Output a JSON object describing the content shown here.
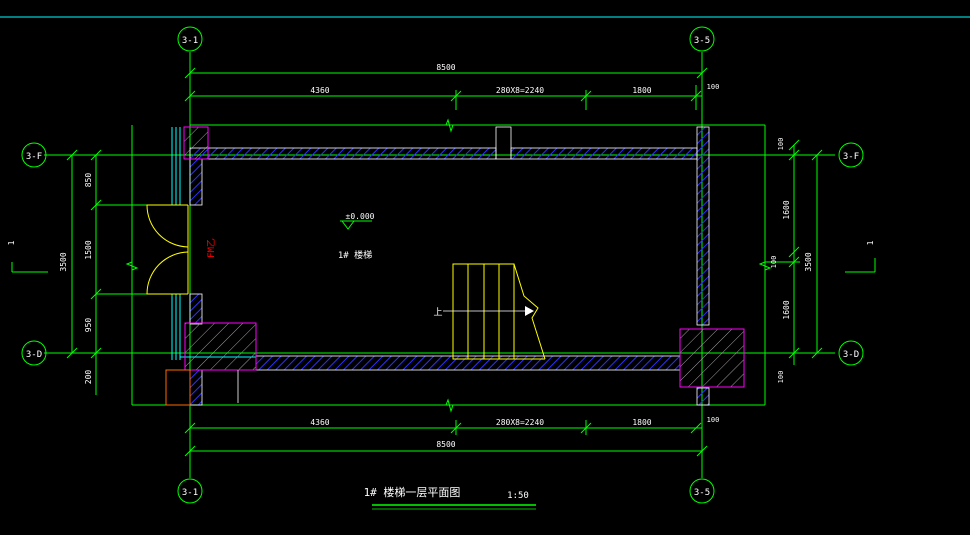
{
  "drawing": {
    "title": "1# 楼梯一层平面图",
    "scale": "1:50",
    "room_label": "1# 楼梯",
    "elevation_mark": "±0.000",
    "stair_up_label": "上",
    "door_tag": "FM乙",
    "section_mark_left": "1",
    "section_mark_right": "1"
  },
  "axes": {
    "top_left": "3-1",
    "top_right": "3-5",
    "bottom_left": "3-1",
    "bottom_right": "3-5",
    "left_top": "3-F",
    "left_bottom": "3-D",
    "right_top": "3-F",
    "right_bottom": "3-D"
  },
  "dimensions": {
    "top_total": "8500",
    "top_seg_1": "4360",
    "top_seg_2": "280X8=2240",
    "top_seg_3": "1800",
    "top_seg_4": "100",
    "bottom_total": "8500",
    "bottom_seg_1": "4360",
    "bottom_seg_2": "280X8=2240",
    "bottom_seg_3": "1800",
    "bottom_seg_4": "100",
    "left_total": "3500",
    "left_seg_1": "850",
    "left_seg_2": "1500",
    "left_seg_3": "950",
    "left_seg_4": "200",
    "right_total": "3500",
    "right_seg_1": "100",
    "right_seg_2": "1600",
    "right_seg_3": "100",
    "right_seg_4": "1600",
    "right_seg_5": "100"
  },
  "colors": {
    "background": "#000000",
    "dimension": "#00ff00",
    "axis_circle": "#00ff00",
    "wall_hatch": "#0000ff",
    "wall_outline": "#ffffff",
    "column_outline": "#ff00ff",
    "stair": "#ffff00",
    "door_tag": "#ff0000",
    "cyan_line": "#00ffff"
  }
}
